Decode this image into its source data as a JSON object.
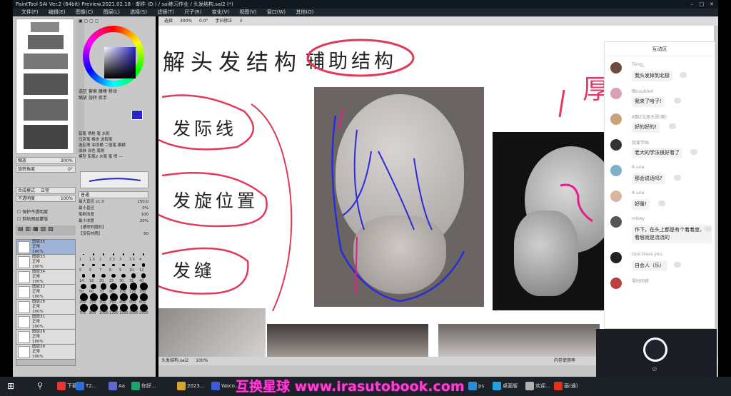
{
  "window": {
    "title": "PaintTool SAI Ver.2 (64bit) Preview.2021.02.18 - 邮件 (D:) / sai练习作业 / 头发结构.sai2 (*)",
    "min": "–",
    "max": "□",
    "close": "✕"
  },
  "menu": [
    "文件(F)",
    "编辑(E)",
    "图像(C)",
    "图层(L)",
    "选择(S)",
    "滤镜(T)",
    "尺子(R)",
    "变化(V)",
    "视图(V)",
    "窗口(W)",
    "其他(O)"
  ],
  "navigator": {
    "zoom_label": "缩放",
    "zoom": "300%",
    "angle_label": "旋转角度",
    "angle": "0°"
  },
  "canvas_toolbar": {
    "mode": "选择",
    "zoom": "300%",
    "angle": "0.0°",
    "shake_label": "手抖修正",
    "shake": "3"
  },
  "tools": {
    "row1": [
      "选区",
      "套索",
      "魔棒",
      "移动",
      "缩放",
      "旋转",
      "抓手"
    ],
    "row2": [
      "铅笔",
      "喷枪",
      "笔",
      "水彩",
      "马克笔",
      "橡皮",
      "选取笔"
    ],
    "row3": [
      "选区擦",
      "油漆桶",
      "二值笔",
      "模糊",
      "涂抹",
      "涂色",
      "笔刷"
    ],
    "row4": [
      "模型",
      "铅笔2",
      "水笔",
      "笔",
      "喷",
      "—"
    ]
  },
  "brush": {
    "mode": "普通",
    "max_size_label": "最大直径",
    "max_size": "x1.0",
    "size": "150.0",
    "min_size_label": "最小直径",
    "min_size": "0%",
    "density_label": "笔刷浓度",
    "density": "100",
    "min_density_label": "最小浓度",
    "min_density": "20%",
    "shape": "【通常的圆形】",
    "texture": "【没有材质】",
    "texture_val": "50"
  },
  "layers": {
    "blend_label": "合成模式",
    "blend": "正常",
    "opacity_label": "不透明度",
    "opacity": "100%",
    "protect": "保护不透明度",
    "clip": "剪贴图层蒙版",
    "items": [
      {
        "name": "图层35",
        "mode": "正常",
        "op": "100%"
      },
      {
        "name": "图层33",
        "mode": "正常",
        "op": "100%"
      },
      {
        "name": "图层34",
        "mode": "正常",
        "op": "100%"
      },
      {
        "name": "图层32",
        "mode": "正常",
        "op": "100%"
      },
      {
        "name": "图层28",
        "mode": "正常",
        "op": "100%"
      },
      {
        "name": "图层31",
        "mode": "正常",
        "op": "100%"
      },
      {
        "name": "图层26",
        "mode": "正常",
        "op": "100%"
      },
      {
        "name": "图层29",
        "mode": "正常",
        "op": "100%"
      }
    ]
  },
  "brush_sizes": [
    "1",
    "1.5",
    "2",
    "2.3",
    "3",
    "3.5",
    "4",
    "5",
    "6",
    "7",
    "8",
    "9",
    "10",
    "12",
    "14",
    "16",
    "20",
    "25",
    "30",
    "35",
    "40",
    "50",
    "60",
    "70",
    "80",
    "100",
    "120",
    "160",
    "200",
    "250",
    "300",
    "350",
    "400",
    "500",
    "600",
    "700",
    "800",
    "1000",
    "1200",
    "1500",
    "2000",
    "2500"
  ],
  "annotations": {
    "title": "解头发结构",
    "aux": "辅助结构",
    "hairline": "发际线",
    "whorl": "发旋位置",
    "part": "发缝",
    "side_char": "厚"
  },
  "chat": {
    "header": "互动区",
    "messages": [
      {
        "name": "Tsing_",
        "text": "我头发掉到北极"
      },
      {
        "name": "图coubleX",
        "text": "我来了哈子!"
      },
      {
        "name": "A飘Z北极光里(蔡)",
        "text": "好的好的!"
      },
      {
        "name": "我爱学画",
        "text": "老大的学法很好看了"
      },
      {
        "name": "A une",
        "text": "那会说话吗?"
      },
      {
        "name": "A une",
        "text": "好暖!"
      },
      {
        "name": "mikey",
        "text": "作下，在头上都是有个着着度，看层就是流流的"
      },
      {
        "name": "God bless you.",
        "text": "自会人（乐）"
      },
      {
        "name": "零时同修",
        "text": ""
      }
    ]
  },
  "statusbar": {
    "file": "头发结构.sai2",
    "zoom": "100%",
    "memory": "内存使用率"
  },
  "taskbar": {
    "items": [
      "下载",
      "T2...",
      "Aa",
      "你好...",
      "2023...",
      "Waco...",
      "ps",
      "桌面版",
      "欢迎...",
      "画(通)"
    ],
    "time": "..."
  },
  "watermark": "互换星球 www.irasutobook.com",
  "colors": {
    "accent": "#ff3fd2",
    "primary": "#2a25c8"
  }
}
